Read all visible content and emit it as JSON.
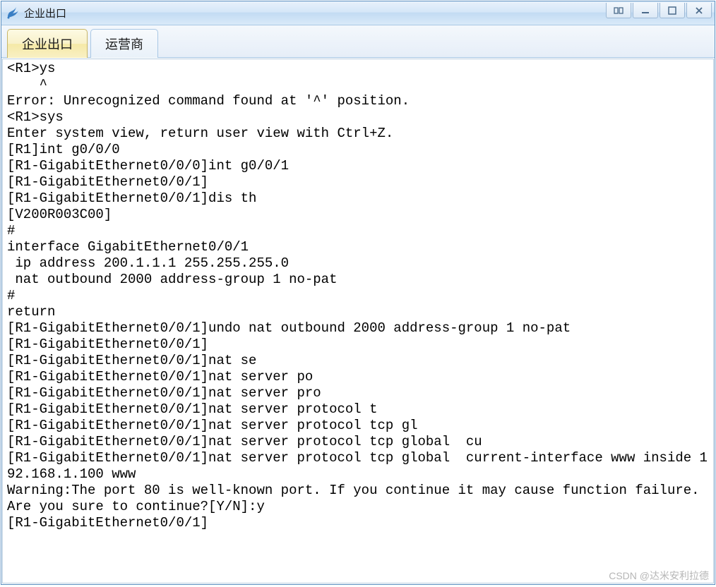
{
  "window": {
    "title": "企业出口"
  },
  "tabs": {
    "active": "企业出口",
    "inactive": "运营商"
  },
  "terminal": {
    "content": "<R1>ys\n    ^\nError: Unrecognized command found at '^' position.\n<R1>sys\nEnter system view, return user view with Ctrl+Z.\n[R1]int g0/0/0\n[R1-GigabitEthernet0/0/0]int g0/0/1\n[R1-GigabitEthernet0/0/1]\n[R1-GigabitEthernet0/0/1]dis th\n[V200R003C00]\n#\ninterface GigabitEthernet0/0/1\n ip address 200.1.1.1 255.255.255.0\n nat outbound 2000 address-group 1 no-pat\n#\nreturn\n[R1-GigabitEthernet0/0/1]undo nat outbound 2000 address-group 1 no-pat\n[R1-GigabitEthernet0/0/1]\n[R1-GigabitEthernet0/0/1]nat se\n[R1-GigabitEthernet0/0/1]nat server po\n[R1-GigabitEthernet0/0/1]nat server pro\n[R1-GigabitEthernet0/0/1]nat server protocol t\n[R1-GigabitEthernet0/0/1]nat server protocol tcp gl\n[R1-GigabitEthernet0/0/1]nat server protocol tcp global  cu\n[R1-GigabitEthernet0/0/1]nat server protocol tcp global  current-interface www inside 192.168.1.100 www\nWarning:The port 80 is well-known port. If you continue it may cause function failure.\nAre you sure to continue?[Y/N]:y\n[R1-GigabitEthernet0/0/1]"
  },
  "watermark": "CSDN @达米安利拉德"
}
